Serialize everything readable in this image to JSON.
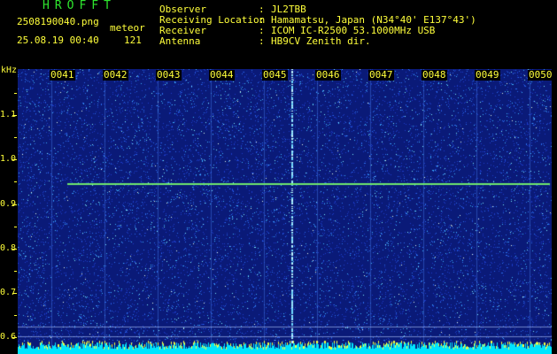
{
  "header": {
    "app_title": "HROFFT",
    "file_name": "2508190040.png",
    "meteor_label": "meteor",
    "date_time": "25.08.19 00:40",
    "meteor_count": "121"
  },
  "info": [
    {
      "label": "Observer",
      "value": "JL2TBB"
    },
    {
      "label": "Receiving Location",
      "value": "Hamamatsu, Japan (N34°40' E137°43')"
    },
    {
      "label": "Receiver",
      "value": "ICOM IC-R2500 53.1000MHz USB"
    },
    {
      "label": "Antenna",
      "value": "HB9CV Zenith dir."
    }
  ],
  "separator": ":",
  "time_axis": {
    "labels": [
      "0041",
      "0042",
      "0043",
      "0044",
      "0045",
      "0046",
      "0047",
      "0048",
      "0049",
      "0050"
    ]
  },
  "freq_axis": {
    "unit": "kHz",
    "labels": [
      "1.1",
      "1.0",
      "0.9",
      "0.8",
      "0.7",
      "0.6"
    ],
    "range_khz": [
      0.58,
      1.2
    ]
  },
  "spectrogram": {
    "carrier_freq_khz": 0.93,
    "colors": {
      "background": "#0a1a78",
      "carrier": "#6ee86e",
      "bottom_band": "#00e5ff",
      "label_yellow": "#ffff3a",
      "title_green": "#2ee62e"
    }
  }
}
